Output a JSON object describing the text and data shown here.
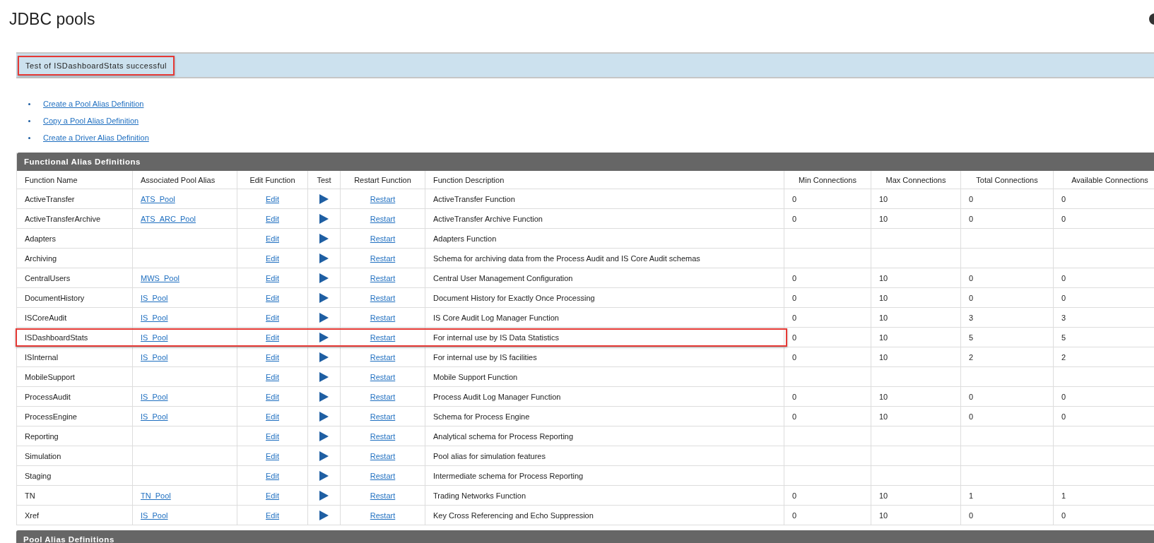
{
  "page": {
    "title": "JDBC pools"
  },
  "message": {
    "text": "Test of ISDashboardStats successful",
    "highlighted": true
  },
  "links": [
    "Create a Pool Alias Definition",
    "Copy a Pool Alias Definition",
    "Create a Driver Alias Definition"
  ],
  "functional_aliases": {
    "title": "Functional Alias Definitions",
    "columns": [
      "Function Name",
      "Associated Pool Alias",
      "Edit Function",
      "Test",
      "Restart Function",
      "Function Description",
      "Min Connections",
      "Max Connections",
      "Total Connections",
      "Available Connections"
    ],
    "rows": [
      {
        "name": "ActiveTransfer",
        "pool": "ATS_Pool",
        "edit": "Edit",
        "restart": "Restart",
        "description": "ActiveTransfer Function",
        "min": "0",
        "max": "10",
        "total": "0",
        "available": "0",
        "highlighted": false
      },
      {
        "name": "ActiveTransferArchive",
        "pool": "ATS_ARC_Pool",
        "edit": "Edit",
        "restart": "Restart",
        "description": "ActiveTransfer Archive Function",
        "min": "0",
        "max": "10",
        "total": "0",
        "available": "0",
        "highlighted": false
      },
      {
        "name": "Adapters",
        "edit": "Edit",
        "restart": "Restart",
        "description": "Adapters Function",
        "highlighted": false
      },
      {
        "name": "Archiving",
        "edit": "Edit",
        "restart": "Restart",
        "description": "Schema for archiving data from the Process Audit and IS Core Audit schemas",
        "highlighted": false
      },
      {
        "name": "CentralUsers",
        "pool": "MWS_Pool",
        "edit": "Edit",
        "restart": "Restart",
        "description": "Central User Management Configuration",
        "min": "0",
        "max": "10",
        "total": "0",
        "available": "0",
        "highlighted": false
      },
      {
        "name": "DocumentHistory",
        "pool": "IS_Pool",
        "edit": "Edit",
        "restart": "Restart",
        "description": "Document History for Exactly Once Processing",
        "min": "0",
        "max": "10",
        "total": "0",
        "available": "0",
        "highlighted": false
      },
      {
        "name": "ISCoreAudit",
        "pool": "IS_Pool",
        "edit": "Edit",
        "restart": "Restart",
        "description": "IS Core Audit Log Manager Function",
        "min": "0",
        "max": "10",
        "total": "3",
        "available": "3",
        "highlighted": false
      },
      {
        "name": "ISDashboardStats",
        "pool": "IS_Pool",
        "edit": "Edit",
        "restart": "Restart",
        "description": "For internal use by IS Data Statistics",
        "min": "0",
        "max": "10",
        "total": "5",
        "available": "5",
        "highlighted": true
      },
      {
        "name": "ISInternal",
        "pool": "IS_Pool",
        "edit": "Edit",
        "restart": "Restart",
        "description": "For internal use by IS facilities",
        "min": "0",
        "max": "10",
        "total": "2",
        "available": "2",
        "highlighted": false
      },
      {
        "name": "MobileSupport",
        "edit": "Edit",
        "restart": "Restart",
        "description": "Mobile Support Function",
        "highlighted": false
      },
      {
        "name": "ProcessAudit",
        "pool": "IS_Pool",
        "edit": "Edit",
        "restart": "Restart",
        "description": "Process Audit Log Manager Function",
        "min": "0",
        "max": "10",
        "total": "0",
        "available": "0",
        "highlighted": false
      },
      {
        "name": "ProcessEngine",
        "pool": "IS_Pool",
        "edit": "Edit",
        "restart": "Restart",
        "description": "Schema for Process Engine",
        "min": "0",
        "max": "10",
        "total": "0",
        "available": "0",
        "highlighted": false
      },
      {
        "name": "Reporting",
        "edit": "Edit",
        "restart": "Restart",
        "description": "Analytical schema for Process Reporting",
        "highlighted": false
      },
      {
        "name": "Simulation",
        "edit": "Edit",
        "restart": "Restart",
        "description": "Pool alias for simulation features",
        "highlighted": false
      },
      {
        "name": "Staging",
        "edit": "Edit",
        "restart": "Restart",
        "description": "Intermediate schema for Process Reporting",
        "highlighted": false
      },
      {
        "name": "TN",
        "pool": "TN_Pool",
        "edit": "Edit",
        "restart": "Restart",
        "description": "Trading Networks Function",
        "min": "0",
        "max": "10",
        "total": "1",
        "available": "1",
        "highlighted": false
      },
      {
        "name": "Xref",
        "pool": "IS_Pool",
        "edit": "Edit",
        "restart": "Restart",
        "description": "Key Cross Referencing and Echo Suppression",
        "min": "0",
        "max": "10",
        "total": "0",
        "available": "0",
        "highlighted": false
      }
    ]
  },
  "pool_aliases": {
    "title": "Pool Alias Definitions"
  }
}
